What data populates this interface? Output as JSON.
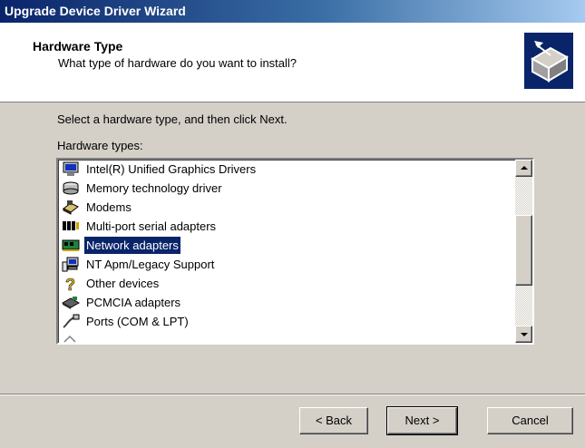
{
  "window": {
    "title": "Upgrade Device Driver Wizard"
  },
  "header": {
    "title": "Hardware Type",
    "subtitle": "What type of hardware do you want to install?",
    "icon": "hardware-wizard-icon"
  },
  "instruction": "Select a hardware type, and then click Next.",
  "list": {
    "label": "Hardware types:",
    "items": [
      {
        "label": "Intel(R) Unified Graphics Drivers",
        "icon": "display-icon"
      },
      {
        "label": "Memory technology driver",
        "icon": "drive-icon"
      },
      {
        "label": "Modems",
        "icon": "modem-icon"
      },
      {
        "label": "Multi-port serial adapters",
        "icon": "serial-port-icon"
      },
      {
        "label": "Network adapters",
        "icon": "network-adapter-icon",
        "selected": true
      },
      {
        "label": "NT Apm/Legacy Support",
        "icon": "computer-icon"
      },
      {
        "label": "Other devices",
        "icon": "question-icon"
      },
      {
        "label": "PCMCIA adapters",
        "icon": "pcmcia-icon"
      },
      {
        "label": "Ports (COM & LPT)",
        "icon": "port-icon"
      }
    ]
  },
  "buttons": {
    "back": "< Back",
    "next": "Next >",
    "cancel": "Cancel"
  },
  "colors": {
    "selection": "#0a246a",
    "dialog_bg": "#d4d0c8",
    "title_start": "#0a246a",
    "title_end": "#a6caf0"
  }
}
